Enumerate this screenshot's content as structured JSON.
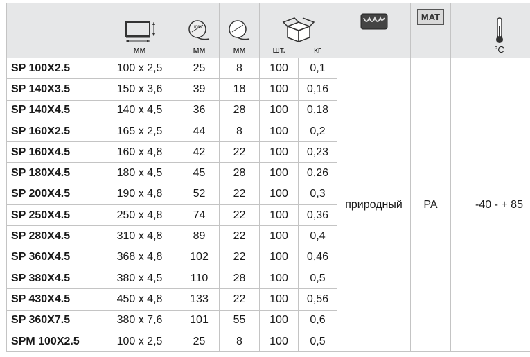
{
  "header": {
    "units": [
      "мм",
      "мм",
      "мм",
      "шт.",
      "кг"
    ],
    "mat_badge": "MAT",
    "temp_unit": "°C",
    "icons": [
      "dimensions-icon",
      "bundle-diameter-icon",
      "clamp-range-icon",
      "box-icon",
      "color-bucket-icon",
      "material-badge-icon",
      "thermometer-icon"
    ]
  },
  "shared": {
    "color": "природный",
    "material": "PA",
    "temperature": "-40 - + 85"
  },
  "rows": [
    [
      "SP 100X2.5",
      "100 x 2,5",
      "25",
      "8",
      "100",
      "0,1"
    ],
    [
      "SP 140X3.5",
      "150 x 3,6",
      "39",
      "18",
      "100",
      "0,16"
    ],
    [
      "SP 140X4.5",
      "140 x 4,5",
      "36",
      "28",
      "100",
      "0,18"
    ],
    [
      "SP 160X2.5",
      "165 x 2,5",
      "44",
      "8",
      "100",
      "0,2"
    ],
    [
      "SP 160X4.5",
      "160 x 4,8",
      "42",
      "22",
      "100",
      "0,23"
    ],
    [
      "SP 180X4.5",
      "180 x 4,5",
      "45",
      "28",
      "100",
      "0,26"
    ],
    [
      "SP 200X4.5",
      "190 x 4,8",
      "52",
      "22",
      "100",
      "0,3"
    ],
    [
      "SP 250X4.5",
      "250 x 4,8",
      "74",
      "22",
      "100",
      "0,36"
    ],
    [
      "SP 280X4.5",
      "310 x 4,8",
      "89",
      "22",
      "100",
      "0,4"
    ],
    [
      "SP 360X4.5",
      "368 x 4,8",
      "102",
      "22",
      "100",
      "0,46"
    ],
    [
      "SP 380X4.5",
      "380 x 4,5",
      "110",
      "28",
      "100",
      "0,5"
    ],
    [
      "SP 430X4.5",
      "450 x 4,8",
      "133",
      "22",
      "100",
      "0,56"
    ],
    [
      "SP 360X7.5",
      "380 x 7,6",
      "101",
      "55",
      "100",
      "0,6"
    ],
    [
      "SPM 100X2.5",
      "100 x 2,5",
      "25",
      "8",
      "100",
      "0,5"
    ]
  ]
}
